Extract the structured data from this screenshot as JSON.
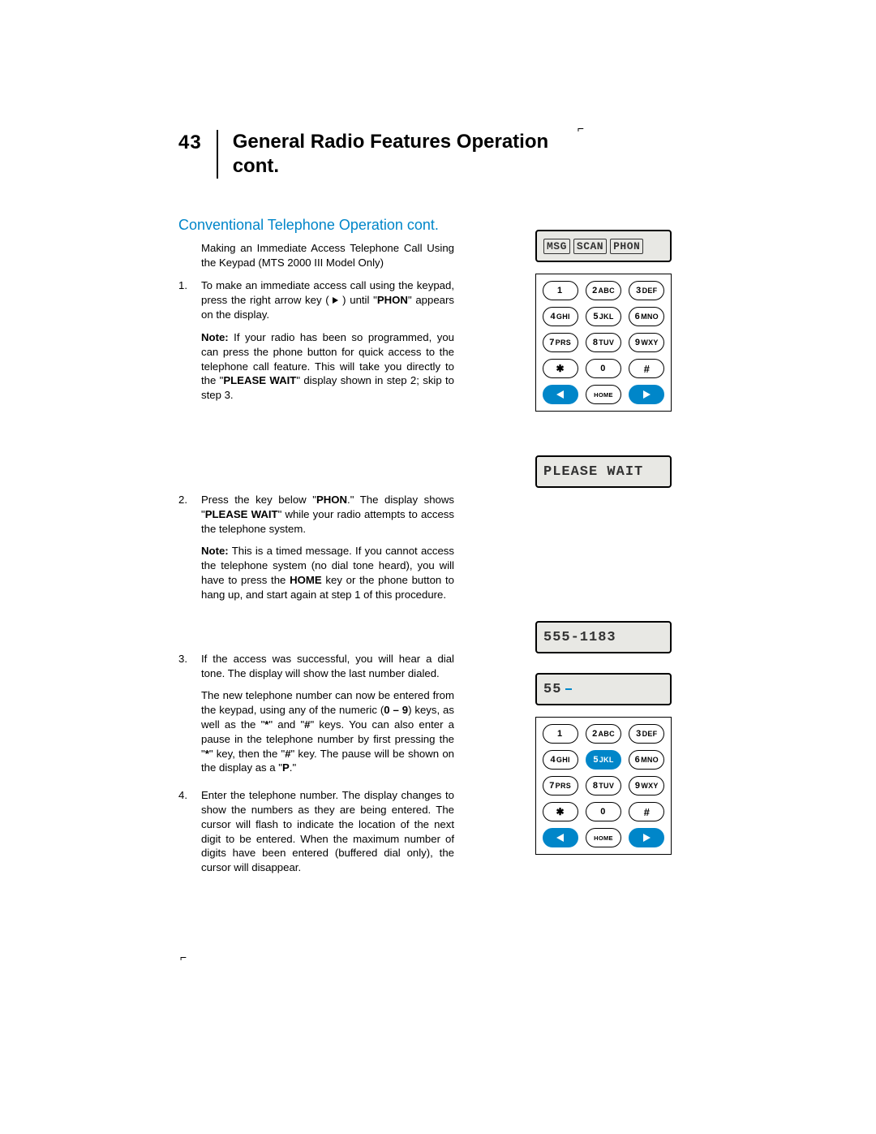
{
  "page_number": "43",
  "title_line1": "General Radio Features Operation",
  "title_line2": "cont.",
  "subheading": "Conventional Telephone Operation cont.",
  "intro": "Making an Immediate Access Telephone Call Using the Keypad (MTS 2000 III Model Only)",
  "step1_num": "1.",
  "step1_body_a": "To make an immediate access call using the keypad, press the right arrow key (",
  "step1_body_b": ") until \"",
  "step1_phon": "PHON",
  "step1_body_c": "\" appears on the display.",
  "step1_note_label": "Note:",
  "step1_note_a": " If your radio has been so programmed, you can press the phone button for quick access to the telephone call feature. This will take you directly to the \"",
  "step1_note_bold": "PLEASE WAIT",
  "step1_note_b": "\" display shown in step 2; skip to step 3.",
  "step2_num": "2.",
  "step2_body_a": "Press the key below \"",
  "step2_bold1": "PHON",
  "step2_body_b": ".\" The display shows \"",
  "step2_bold2": "PLEASE WAIT",
  "step2_body_c": "\" while your radio attempts to access the telephone system.",
  "step2_note_label": "Note:",
  "step2_note_a": " This is a timed message. If you cannot access the telephone system (no dial tone heard), you will have to press the ",
  "step2_note_bold": "HOME",
  "step2_note_b": " key or the phone button to hang up, and start again at step 1 of this procedure.",
  "step3_num": "3.",
  "step3_body": "If the access was successful, you will hear a dial tone. The display will show the last number dialed.",
  "step3_p2_a": "The new telephone number can now be entered from the keypad, using any of the numeric (",
  "step3_p2_bold1": "0 – 9",
  "step3_p2_b": ") keys, as well as the \"",
  "step3_p2_bold2": "*",
  "step3_p2_c": "\" and \"",
  "step3_p2_bold3": "#",
  "step3_p2_d": "\" keys. You can also enter a pause in the telephone number by first pressing the \"",
  "step3_p2_bold4": "*",
  "step3_p2_e": "\" key, then the \"",
  "step3_p2_bold5": "#",
  "step3_p2_f": "\" key. The pause will be shown on the display as a \"",
  "step3_p2_bold6": "P",
  "step3_p2_g": ".\"",
  "step4_num": "4.",
  "step4_body": "Enter the telephone number. The display changes to show the numbers as they are being entered. The cursor will flash to indicate the location of the next digit to be entered. When the maximum number of digits have been entered (buffered dial only), the cursor will disappear.",
  "lcd1_seg1": "MSG",
  "lcd1_seg2": "SCAN",
  "lcd1_seg3": "PHON",
  "lcd2_text": "PLEASE WAIT",
  "lcd3_text": "555-1183",
  "lcd4_text": "55",
  "keys": {
    "k1": "1",
    "k2a": "2",
    "k2b": "ABC",
    "k3a": "3",
    "k3b": "DEF",
    "k4a": "4",
    "k4b": "GHI",
    "k5a": "5",
    "k5b": "JKL",
    "k6a": "6",
    "k6b": "MNO",
    "k7a": "7",
    "k7b": "PRS",
    "k8a": "8",
    "k8b": "TUV",
    "k9a": "9",
    "k9b": "WXY",
    "k0": "0",
    "home": "HOME"
  }
}
